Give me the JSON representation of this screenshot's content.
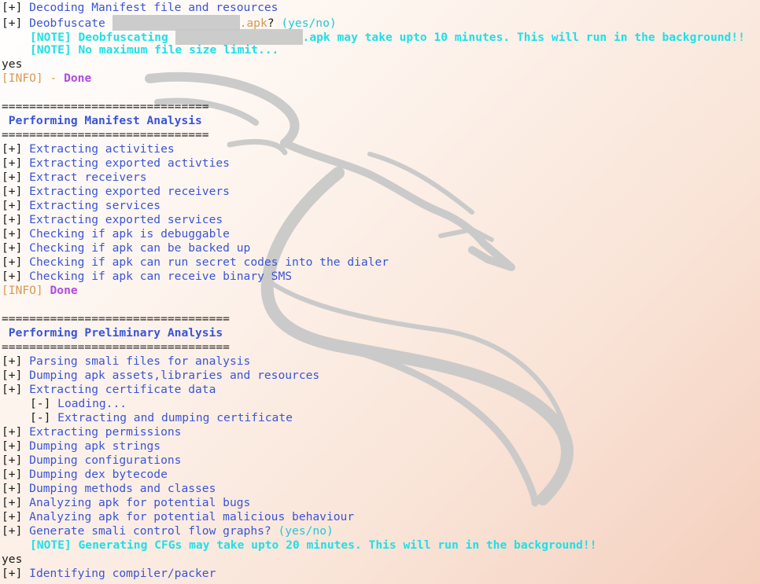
{
  "lines": [
    {
      "k": "item",
      "text": "Decoding Manifest file and resources"
    },
    {
      "k": "deob",
      "label": "Deobfuscate",
      "ext": ".apk",
      "q": "?",
      "yn": "(yes/no)"
    },
    {
      "k": "note1",
      "tag": "[NOTE]",
      "label": "Deobfuscating",
      "ext": ".apk",
      "rest": "may take upto 10 minutes. This will run in the background!!"
    },
    {
      "k": "note",
      "tag": "[NOTE]",
      "text": "No maximum file size limit..."
    },
    {
      "k": "plain",
      "text": "yes"
    },
    {
      "k": "info",
      "tag": "[INFO]",
      "sep": "-",
      "text": "Done"
    },
    {
      "k": "blank"
    },
    {
      "k": "rule",
      "text": "=============================="
    },
    {
      "k": "heading",
      "text": " Performing Manifest Analysis"
    },
    {
      "k": "rule",
      "text": "=============================="
    },
    {
      "k": "item",
      "text": "Extracting activities"
    },
    {
      "k": "item",
      "text": "Extracting exported activties"
    },
    {
      "k": "item",
      "text": "Extract receivers"
    },
    {
      "k": "item",
      "text": "Extracting exported receivers"
    },
    {
      "k": "item",
      "text": "Extracting services"
    },
    {
      "k": "item",
      "text": "Extracting exported services"
    },
    {
      "k": "item",
      "text": "Checking if apk is debuggable"
    },
    {
      "k": "item",
      "text": "Checking if apk can be backed up"
    },
    {
      "k": "item",
      "text": "Checking if apk can run secret codes into the dialer"
    },
    {
      "k": "item",
      "text": "Checking if apk can receive binary SMS"
    },
    {
      "k": "info2",
      "tag": "[INFO]",
      "text": "Done"
    },
    {
      "k": "blank"
    },
    {
      "k": "rule",
      "text": "================================="
    },
    {
      "k": "heading",
      "text": " Performing Preliminary Analysis"
    },
    {
      "k": "rule",
      "text": "================================="
    },
    {
      "k": "item",
      "text": "Parsing smali files for analysis"
    },
    {
      "k": "item",
      "text": "Dumping apk assets,libraries and resources"
    },
    {
      "k": "item",
      "text": "Extracting certificate data"
    },
    {
      "k": "sub",
      "text": "Loading..."
    },
    {
      "k": "sub",
      "text": "Extracting and dumping certificate"
    },
    {
      "k": "item",
      "text": "Extracting permissions"
    },
    {
      "k": "item",
      "text": "Dumping apk strings"
    },
    {
      "k": "item",
      "text": "Dumping configurations"
    },
    {
      "k": "item",
      "text": "Dumping dex bytecode"
    },
    {
      "k": "item",
      "text": "Dumping methods and classes"
    },
    {
      "k": "item",
      "text": "Analyzing apk for potential bugs"
    },
    {
      "k": "item",
      "text": "Analyzing apk for potential malicious behaviour"
    },
    {
      "k": "ask",
      "text": "Generate smali control flow graphs?",
      "yn": "(yes/no)"
    },
    {
      "k": "note",
      "tag": "[NOTE]",
      "text": "Generating CFGs may take upto 20 minutes. This will run in the background!!"
    },
    {
      "k": "plain",
      "text": "yes"
    },
    {
      "k": "item",
      "text": "Identifying compiler/packer"
    }
  ],
  "markers": {
    "plus": "[+]",
    "minus": "[-]"
  },
  "colors": {
    "blue": "#3a55d6",
    "cyan": "#1ee0e6",
    "orange": "#d69a52",
    "purple": "#b04adf",
    "redaction": "#c8c8c8"
  },
  "icons": {
    "watermark": "kali-dragon-icon"
  }
}
